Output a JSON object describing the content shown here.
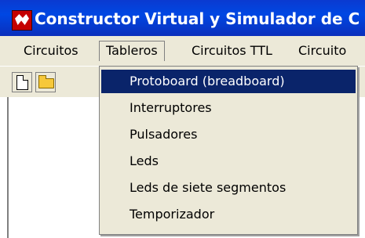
{
  "window": {
    "title": "Constructor Virtual y Simulador de C"
  },
  "menubar": {
    "items": [
      {
        "label": "Circuitos"
      },
      {
        "label": "Tableros"
      },
      {
        "label": "Circuitos TTL"
      },
      {
        "label": "Circuito"
      }
    ]
  },
  "toolbar": {
    "icons": [
      "new-document-icon",
      "open-folder-icon"
    ]
  },
  "dropdown": {
    "items": [
      {
        "label": "Protoboard (breadboard)",
        "selected": true
      },
      {
        "label": "Interruptores"
      },
      {
        "label": "Pulsadores"
      },
      {
        "label": "Leds"
      },
      {
        "label": "Leds de siete segmentos"
      },
      {
        "label": "Temporizador"
      }
    ]
  },
  "colors": {
    "titlebar": "#0047e3",
    "menu_bg": "#ece9d8",
    "selection": "#0a246a"
  }
}
